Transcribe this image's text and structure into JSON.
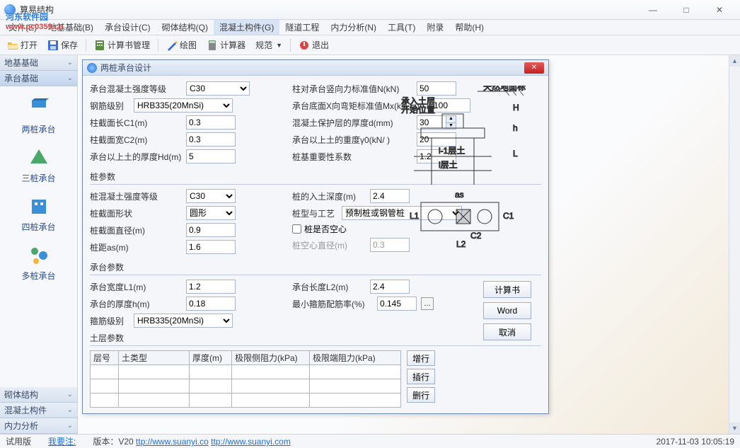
{
  "watermark": {
    "text": "河东软件园",
    "url": "www.pc0359.cn"
  },
  "titlebar": {
    "title": "算易结构"
  },
  "win_controls": {
    "min": "—",
    "max": "□",
    "close": "✕"
  },
  "menu": [
    {
      "label": "文件(E)"
    },
    {
      "label": "地基基础(B)"
    },
    {
      "label": "承台设计(C)"
    },
    {
      "label": "砌体结构(Q)"
    },
    {
      "label": "混凝土构件(G)"
    },
    {
      "label": "隧道工程"
    },
    {
      "label": "内力分析(N)"
    },
    {
      "label": "工具(T)"
    },
    {
      "label": "附录"
    },
    {
      "label": "帮助(H)"
    }
  ],
  "toolbar": [
    {
      "icon": "open",
      "label": "打开"
    },
    {
      "icon": "save",
      "label": "保存"
    },
    {
      "icon": "calc-manage",
      "label": "计算书管理"
    },
    {
      "icon": "draw",
      "label": "绘图"
    },
    {
      "icon": "calculator",
      "label": "计算器"
    },
    {
      "icon": "spec",
      "label": "规范"
    },
    {
      "icon": "exit",
      "label": "退出"
    }
  ],
  "sidebar": {
    "sections": [
      {
        "label": "地基基础",
        "expanded": false
      },
      {
        "label": "承台基础",
        "expanded": true,
        "items": [
          {
            "icon": "pile2",
            "label": "两桩承台"
          },
          {
            "icon": "pile3",
            "label": "三桩承台"
          },
          {
            "icon": "pile4",
            "label": "四桩承台"
          },
          {
            "icon": "pilemulti",
            "label": "多桩承台"
          }
        ]
      },
      {
        "label": "砌体结构",
        "expanded": false
      },
      {
        "label": "混凝土构件",
        "expanded": false
      },
      {
        "label": "内力分析",
        "expanded": false
      }
    ]
  },
  "dialog": {
    "title": "两桩承台设计",
    "fields": {
      "concrete_grade_label": "承台混凝土强度等级",
      "concrete_grade": "C30",
      "rebar_grade_label": "钢筋级别",
      "rebar_grade": "HRB335(20MnSi)",
      "c1_label": "柱截面长C1(m)",
      "c1": "0.3",
      "c2_label": "柱截面宽C2(m)",
      "c2": "0.3",
      "hd_label": "承台以上土的厚度Hd(m)",
      "hd": "5",
      "n_label": "柱对承台竖向力标准值N(kN)",
      "n": "50",
      "mx_label": "承台底面X向弯矩标准值Mx(kN.m)",
      "mx": "100",
      "d_label": "混凝土保护层的厚度d(mm)",
      "d": "30",
      "gamma0_label": "承台以上土的重度γ0(kN/  )",
      "gamma0": "20",
      "importance_label": "桩基重要性系数",
      "importance": "1.2",
      "pile_group": "桩参数",
      "pile_concrete_label": "桩混凝土强度等级",
      "pile_concrete": "C30",
      "pile_shape_label": "桩截面形状",
      "pile_shape": "圆形",
      "pile_dia_label": "桩截面直径(m)",
      "pile_dia": "0.9",
      "pile_as_label": "桩距as(m)",
      "pile_as": "1.6",
      "pile_depth_label": "桩的入土深度(m)",
      "pile_depth": "2.4",
      "pile_type_label": "桩型与工艺",
      "pile_type": "预制桩或钢管桩",
      "hollow_label": "桩是否空心",
      "hollow_dia_label": "桩空心直径(m)",
      "hollow_dia": "0.3",
      "cap_group": "承台参数",
      "l1_label": "承台宽度L1(m)",
      "l1": "1.2",
      "h_label": "承台的厚度h(m)",
      "h": "0.18",
      "l2_label": "承台长度L2(m)",
      "l2": "2.4",
      "rho_label": "最小箍筋配筋率(%)",
      "rho": "0.145",
      "stirrup_label": "箍筋级别",
      "stirrup": "HRB335(20MnSi)",
      "soil_group": "土层参数"
    },
    "diagram_labels": {
      "natural": "天然地面标",
      "soil_start": "承入土层",
      "start_pos": "开始位置",
      "layer_im1": "i-1层土",
      "layer_i": "i层土",
      "H": "H",
      "h": "h",
      "L": "L",
      "as": "as",
      "L1": "L1",
      "C1": "C1",
      "C2": "C2",
      "L2": "L2"
    },
    "table": {
      "headers": [
        "层号",
        "土类型",
        "厚度(m)",
        "极限侧阻力(kPa)",
        "极限端阻力(kPa)"
      ]
    },
    "row_btns": {
      "add": "增行",
      "insert": "插行",
      "del": "删行"
    },
    "buttons": {
      "calc": "计算书",
      "word": "Word",
      "cancel": "取消"
    }
  },
  "statusbar": {
    "trial": "试用版",
    "need_label": "我要注:",
    "version_prefix": "版本：V20 ",
    "url1": "ttp://www.suanyi.co",
    "url2": "ttp://www.suanyi.com",
    "timestamp": "2017-11-03 10:05:19"
  }
}
